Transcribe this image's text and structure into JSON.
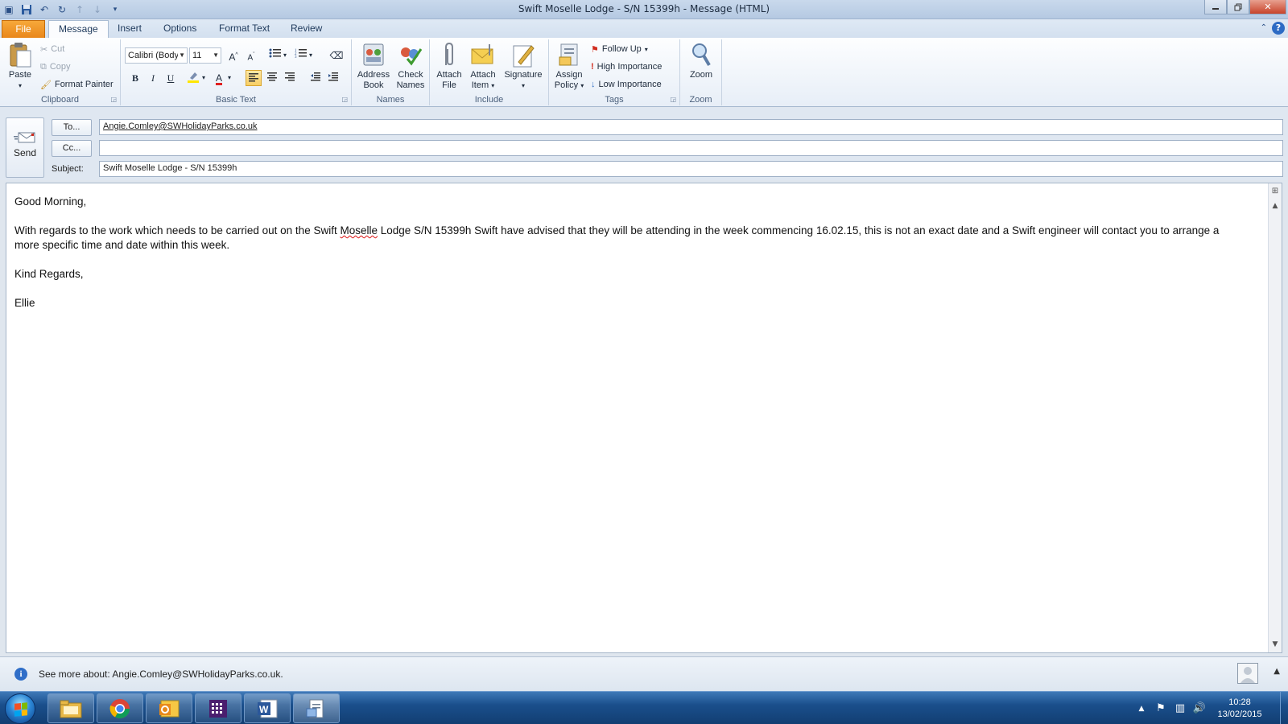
{
  "window": {
    "title": "Swift Moselle Lodge - S/N 15399h  -  Message (HTML)"
  },
  "tabs": [
    {
      "label": "File"
    },
    {
      "label": "Message"
    },
    {
      "label": "Insert"
    },
    {
      "label": "Options"
    },
    {
      "label": "Format Text"
    },
    {
      "label": "Review"
    }
  ],
  "ribbon": {
    "clipboard": {
      "label": "Clipboard",
      "paste": "Paste",
      "cut": "Cut",
      "copy": "Copy",
      "format_painter": "Format Painter"
    },
    "basic_text": {
      "label": "Basic Text",
      "font": "Calibri (Body)",
      "size": "11",
      "bold": "B",
      "italic": "I",
      "underline": "U"
    },
    "names": {
      "label": "Names",
      "address_book_1": "Address",
      "address_book_2": "Book",
      "check_names_1": "Check",
      "check_names_2": "Names"
    },
    "include": {
      "label": "Include",
      "attach_file_1": "Attach",
      "attach_file_2": "File",
      "attach_item_1": "Attach",
      "attach_item_2": "Item",
      "signature": "Signature"
    },
    "tags": {
      "label": "Tags",
      "assign_policy_1": "Assign",
      "assign_policy_2": "Policy",
      "follow_up": "Follow Up",
      "high_importance": "High Importance",
      "low_importance": "Low Importance"
    },
    "zoom": {
      "label": "Zoom",
      "zoom": "Zoom"
    }
  },
  "header": {
    "send": "Send",
    "to_button": "To...",
    "cc_button": "Cc...",
    "subject_label": "Subject:",
    "to_value": "Angie.Comley@SWHolidayParks.co.uk",
    "cc_value": "",
    "subject_value": "Swift Moselle Lodge - S/N 15399h"
  },
  "body": {
    "greeting": "Good Morning,",
    "para_1": "With regards to the work which needs to be carried out on the Swift ",
    "para_spell": "Moselle",
    "para_2": " Lodge S/N 15399h Swift have advised that they will be attending in the week commencing 16.02.15, this is not an exact date and a Swift engineer will contact you to arrange a more specific time and date within this week.",
    "closing": "Kind Regards,",
    "signature": "Ellie"
  },
  "people_pane": {
    "text": "See more about: Angie.Comley@SWHolidayParks.co.uk."
  },
  "taskbar": {
    "time": "10:28",
    "date": "13/02/2015"
  },
  "colors": {
    "file_tab": "#e9871b",
    "accent": "#2d6bc4",
    "taskbar": "#1a4f8c"
  }
}
